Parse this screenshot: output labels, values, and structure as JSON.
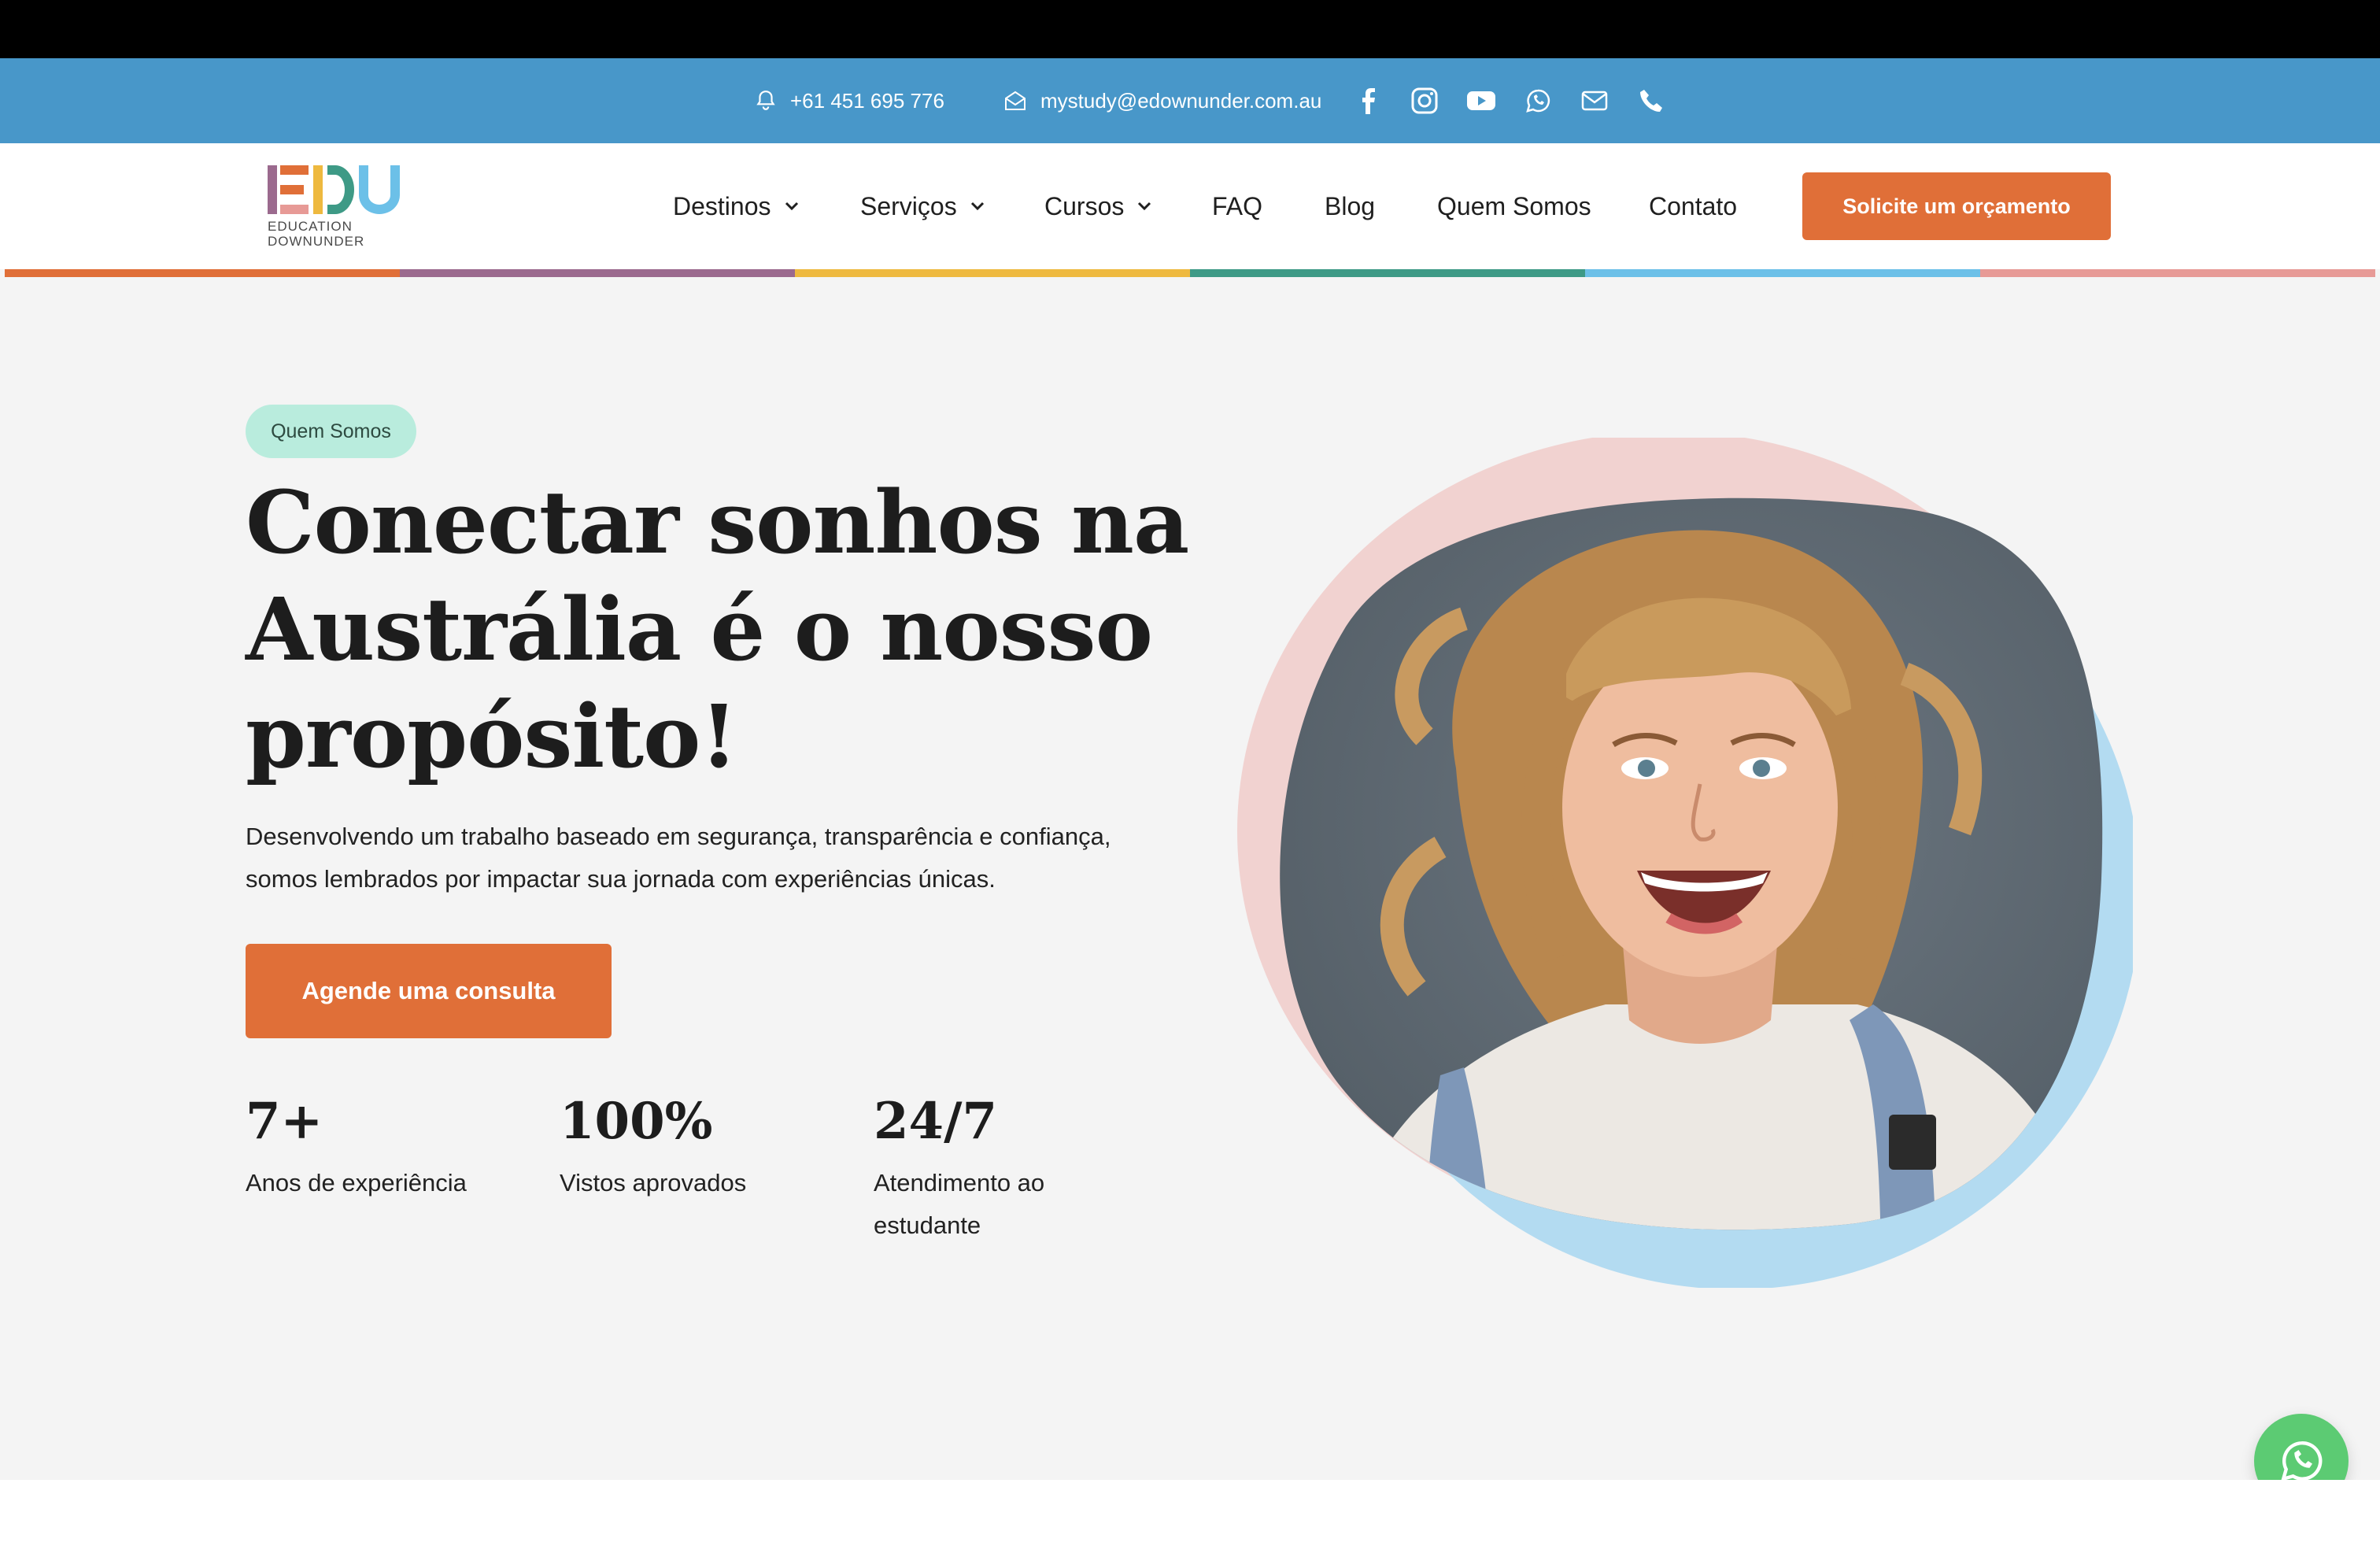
{
  "topbar": {
    "phone": "+61 451 695 776",
    "email": "mystudy@edownunder.com.au",
    "social_icons": [
      "facebook-icon",
      "instagram-icon",
      "youtube-icon",
      "whatsapp-icon",
      "mail-icon",
      "phone-icon"
    ],
    "background_color": "#4897c9"
  },
  "header": {
    "logo": {
      "letters": "EDU",
      "line1": "EDUCATION",
      "line2": "DOWNUNDER"
    },
    "nav": [
      {
        "label": "Destinos",
        "has_dropdown": true
      },
      {
        "label": "Serviços",
        "has_dropdown": true
      },
      {
        "label": "Cursos",
        "has_dropdown": true
      },
      {
        "label": "FAQ",
        "has_dropdown": false
      },
      {
        "label": "Blog",
        "has_dropdown": false
      },
      {
        "label": "Quem Somos",
        "has_dropdown": false
      },
      {
        "label": "Contato",
        "has_dropdown": false
      }
    ],
    "cta_label": "Solicite um orçamento",
    "accent_color": "#e06f38"
  },
  "rainbow_colors": [
    "#e06f38",
    "#9b6a8e",
    "#eeb93f",
    "#3e9a86",
    "#6cc0e8",
    "#e79a96"
  ],
  "hero": {
    "badge": "Quem Somos",
    "title_line1": "Conectar sonhos na",
    "title_line2": "Austrália é o nosso",
    "title_line3": "propósito!",
    "subtitle_line1": "Desenvolvendo um trabalho baseado em segurança, transparência e confiança,",
    "subtitle_line2": "somos lembrados por impactar sua jornada com experiências únicas.",
    "cta_label": "Agende uma consulta",
    "stats": [
      {
        "value": "7+",
        "label_line1": "Anos de experiência",
        "label_line2": ""
      },
      {
        "value": "100%",
        "label_line1": "Vistos aprovados",
        "label_line2": ""
      },
      {
        "value": "24/7",
        "label_line1": "Atendimento ao",
        "label_line2": "estudante"
      }
    ]
  },
  "floating": {
    "whatsapp_color": "#5ccb73"
  }
}
